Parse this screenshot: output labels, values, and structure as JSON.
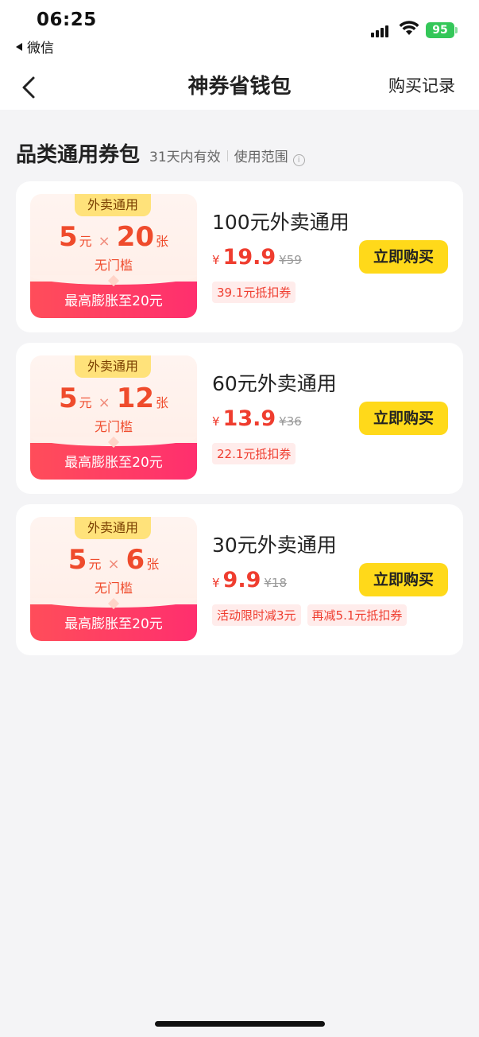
{
  "status": {
    "time": "06:25",
    "back_app": "微信",
    "battery": "95"
  },
  "nav": {
    "title": "神券省钱包",
    "right": "购买记录"
  },
  "section": {
    "title": "品类通用券包",
    "validity": "31天内有效",
    "scope": "使用范围"
  },
  "cards": [
    {
      "tag": "外卖通用",
      "face": "5",
      "face_unit": "元",
      "times": "×",
      "count": "20",
      "count_unit": "张",
      "threshold": "无门槛",
      "bonus": "最高膨胀至20元",
      "title": "100元外卖通用",
      "yen": "¥",
      "price": "19.9",
      "original": "¥59",
      "chips": [
        "39.1元抵扣券"
      ],
      "button": "立即购买"
    },
    {
      "tag": "外卖通用",
      "face": "5",
      "face_unit": "元",
      "times": "×",
      "count": "12",
      "count_unit": "张",
      "threshold": "无门槛",
      "bonus": "最高膨胀至20元",
      "title": "60元外卖通用",
      "yen": "¥",
      "price": "13.9",
      "original": "¥36",
      "chips": [
        "22.1元抵扣券"
      ],
      "button": "立即购买"
    },
    {
      "tag": "外卖通用",
      "face": "5",
      "face_unit": "元",
      "times": "×",
      "count": "6",
      "count_unit": "张",
      "threshold": "无门槛",
      "bonus": "最高膨胀至20元",
      "title": "30元外卖通用",
      "yen": "¥",
      "price": "9.9",
      "original": "¥18",
      "chips": [
        "活动限时减3元",
        "再减5.1元抵扣券"
      ],
      "button": "立即购买"
    }
  ],
  "colors": {
    "accent_red": "#ef3d2f",
    "button_yellow": "#ffd91a",
    "battery_green": "#34c759"
  }
}
